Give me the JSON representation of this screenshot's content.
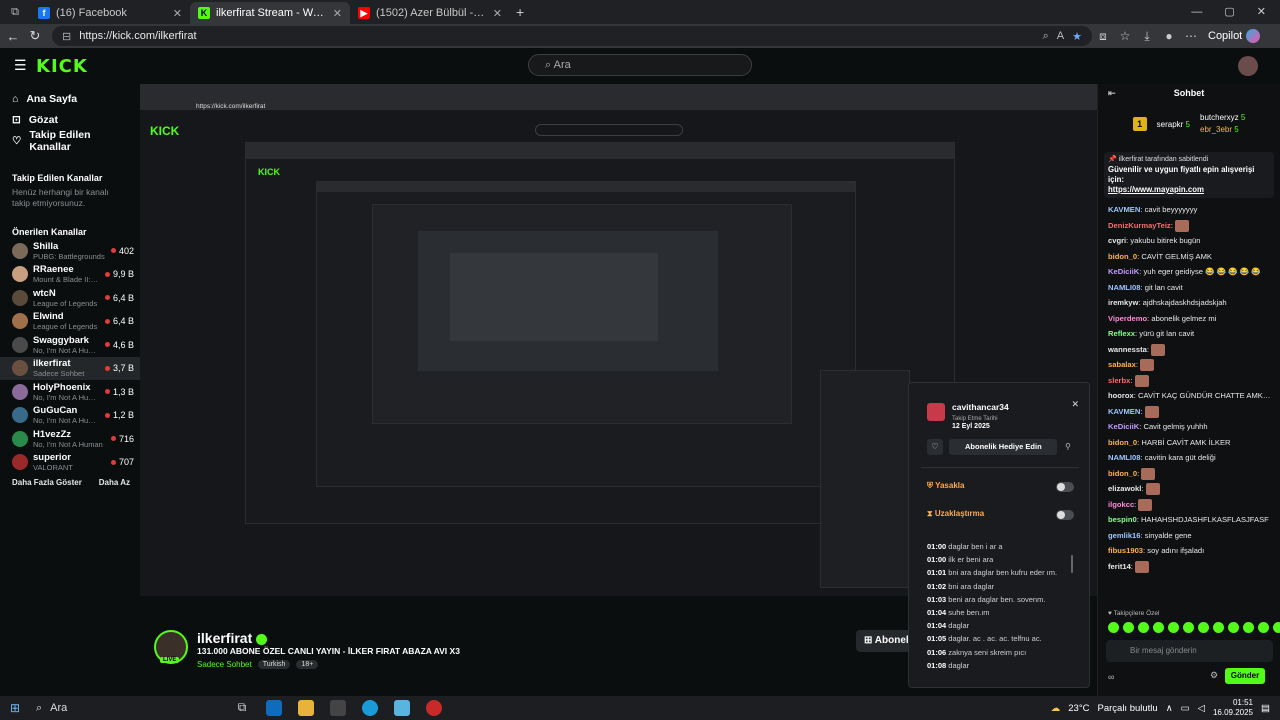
{
  "browser": {
    "tabs": [
      {
        "title": "(16) Facebook",
        "icon": "facebook-icon",
        "color": "#1877f2"
      },
      {
        "title": "ilkerfirat Stream - Watch Live on Kick",
        "icon": "kick-icon",
        "color": "#53fc18"
      },
      {
        "title": "(1502) Azer Bülbül - Felek - YouTube",
        "icon": "youtube-icon",
        "color": "#ff0000"
      }
    ],
    "url": "https://kick.com/ilkerfirat",
    "copilot_label": "Copilot"
  },
  "kick": {
    "logo": "KICK",
    "search_placeholder": "Ara"
  },
  "sidebar": {
    "nav": [
      {
        "label": "Ana Sayfa",
        "icon": "home-icon"
      },
      {
        "label": "Gözat",
        "icon": "browse-icon"
      },
      {
        "label": "Takip Edilen Kanallar",
        "icon": "heart-icon"
      }
    ],
    "followed_title": "Takip Edilen Kanallar",
    "followed_empty": "Henüz herhangi bir kanalı takip etmiyorsunuz.",
    "recommended_title": "Önerilen Kanallar",
    "channels": [
      {
        "name": "Shilla",
        "game": "PUBG: Battlegrounds",
        "viewers": "402",
        "color": "#7a6a5a"
      },
      {
        "name": "RRaenee",
        "game": "Mount & Blade II: Ba...",
        "viewers": "9,9 B",
        "color": "#c8a080"
      },
      {
        "name": "wtcN",
        "game": "League of Legends",
        "viewers": "6,4 B",
        "color": "#5a4a3a"
      },
      {
        "name": "Elwind",
        "game": "League of Legends",
        "viewers": "6,4 B",
        "color": "#a0704a"
      },
      {
        "name": "Swaggybark",
        "game": "No, I'm Not A Human",
        "viewers": "4,6 B",
        "color": "#4a4a4a"
      },
      {
        "name": "ilkerfirat",
        "game": "Sadece Sohbet",
        "viewers": "3,7 B",
        "color": "#6a5040"
      },
      {
        "name": "HolyPhoenix",
        "game": "No, I'm Not A Human",
        "viewers": "1,3 B",
        "color": "#8a6a9a"
      },
      {
        "name": "GuGuCan",
        "game": "No, I'm Not A Human",
        "viewers": "1,2 B",
        "color": "#3a6a8a"
      },
      {
        "name": "H1vezZz",
        "game": "No, I'm Not A Human",
        "viewers": "716",
        "color": "#2a8a4a"
      },
      {
        "name": "superior",
        "game": "VALORANT",
        "viewers": "707",
        "color": "#9a2a2a"
      }
    ],
    "show_more": "Daha Fazla Göster",
    "show_less": "Daha Az"
  },
  "stream": {
    "streamer": "ilkerfirat",
    "title": "131.000 ABONE ÖZEL CANLI YAYIN - İLKER FIRAT ABAZA AVI X3",
    "category": "Sadece Sohbet",
    "tags": [
      "Turkish",
      "18+"
    ],
    "live_badge": "LIVE",
    "subscribe_label": "Abonelik",
    "nested_url": "https://kick.com/ilkerfirat"
  },
  "chat": {
    "title": "Sohbet",
    "leaderboard": [
      {
        "rank": "1",
        "user": "serapkr",
        "count": "5"
      },
      {
        "user": "butcherxyz",
        "count": "5"
      },
      {
        "user": "ebr_3ebr",
        "count": "5"
      }
    ],
    "pinned_by": "ilkerfirat tarafından sabitlendi",
    "pinned_text": "Güvenilir ve uygun fiyatlı epin alışverişi için:",
    "pinned_link": "https://www.mayapin.com",
    "messages": [
      {
        "user": "KAVMEN",
        "color": "#9ec6ff",
        "text": "cavit beyyyyyyy"
      },
      {
        "user": "DenizKurmayTeiz",
        "color": "#ff6b6b",
        "text": ""
      },
      {
        "user": "cvgri",
        "color": "#e8e8e8",
        "text": "yakubu bitirek bugün"
      },
      {
        "user": "bidon_0",
        "color": "#ffb347",
        "text": "CAVİT GELMİŞ AMK"
      },
      {
        "user": "KeDiciiK",
        "color": "#c39bff",
        "text": "yuh eger geidiyse 😂 😂 😂 😂 😂"
      },
      {
        "user": "NAMLI08",
        "color": "#9ec6ff",
        "text": "git lan cavit"
      },
      {
        "user": "iremkyw",
        "color": "#e8e8e8",
        "text": "ajdhskajdaskhdsjadskjah"
      },
      {
        "user": "Viperdemo",
        "color": "#ff8ad8",
        "text": "abonelik gelmez mi"
      },
      {
        "user": "Reflexx",
        "color": "#8aff8a",
        "text": "yürü git lan cavit"
      },
      {
        "user": "wannessta",
        "color": "#e8e8e8",
        "text": ""
      },
      {
        "user": "sabalax",
        "color": "#ffb347",
        "text": ""
      },
      {
        "user": "slerbx",
        "color": "#ff6b6b",
        "text": ""
      },
      {
        "user": "hoorox",
        "color": "#e8e8e8",
        "text": "CAVİT KAÇ GÜNDÜR CHATTE AMK İLKER"
      },
      {
        "user": "KAVMEN",
        "color": "#9ec6ff",
        "text": ""
      },
      {
        "user": "KeDiciiK",
        "color": "#c39bff",
        "text": "Cavit gelmiş yuhhh"
      },
      {
        "user": "bidon_0",
        "color": "#ffb347",
        "text": "HARBİ CAVİT AMK İLKER"
      },
      {
        "user": "NAMLI08",
        "color": "#9ec6ff",
        "text": "cavitin kara güt deliği"
      },
      {
        "user": "bidon_0",
        "color": "#ffb347",
        "text": ""
      },
      {
        "user": "elizawokl",
        "color": "#e8e8e8",
        "text": ""
      },
      {
        "user": "ilgokcc",
        "color": "#ff8ad8",
        "text": ""
      },
      {
        "user": "bespin0",
        "color": "#8aff8a",
        "text": "HAHAHSHDJASHFLKASFLASJFASF"
      },
      {
        "user": "gemlik16",
        "color": "#9ec6ff",
        "text": "sinyalde gene"
      },
      {
        "user": "fibus1903",
        "color": "#ffb347",
        "text": "soy adını ifşaladı"
      },
      {
        "user": "ferit14",
        "color": "#e8e8e8",
        "text": ""
      }
    ],
    "followers_only": "Takipçilere Özel",
    "input_placeholder": "Bir mesaj gönderin",
    "send_label": "Gönder"
  },
  "popup": {
    "username": "cavithancar34",
    "follow_date_label": "Takip Etme Tarihi",
    "follow_date": "12 Eyl 2025",
    "gift_label": "Abonelik Hediye Edin",
    "ban_label": "Yasakla",
    "timeout_label": "Uzaklaştırma",
    "log": [
      {
        "time": "01:00",
        "text": "daglar ben i ar a"
      },
      {
        "time": "01:00",
        "text": "ilk er beni ara"
      },
      {
        "time": "01:01",
        "text": "bni ara daglar ben kufru eder ım."
      },
      {
        "time": "01:02",
        "text": "bni ara daglar"
      },
      {
        "time": "01:03",
        "text": "beni ara daglar ben. sovenm."
      },
      {
        "time": "01:04",
        "text": "suhe ben.ım"
      },
      {
        "time": "01:04",
        "text": "daglar"
      },
      {
        "time": "01:05",
        "text": "daglar. ac . ac. ac. telfnu ac."
      },
      {
        "time": "01:06",
        "text": "zaknya seni skreim pıcı"
      },
      {
        "time": "01:08",
        "text": "daglar"
      }
    ]
  },
  "taskbar": {
    "search_label": "Ara",
    "weather": "23°C",
    "weather_desc": "Parçalı bulutlu",
    "time": "01:51",
    "date": "16.09.2025"
  },
  "colors": {
    "accent": "#53fc18",
    "background": "#0b0e0f"
  }
}
